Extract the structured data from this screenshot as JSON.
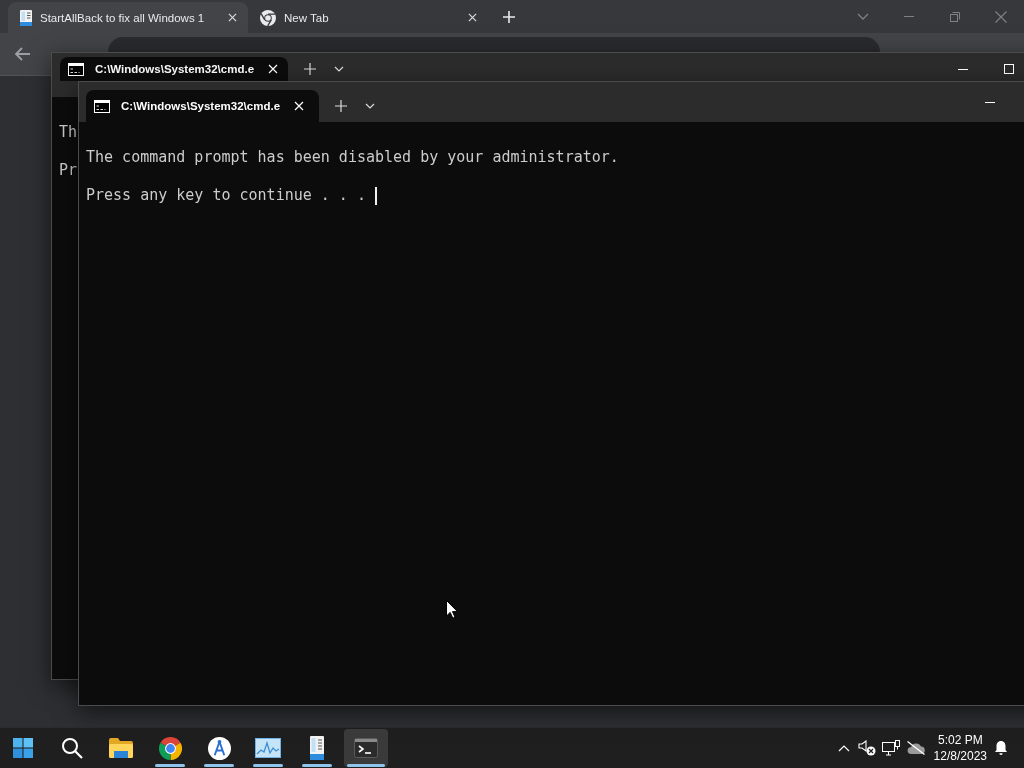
{
  "browser": {
    "tabs": [
      {
        "title": "StartAllBack to fix all Windows 1",
        "selected": true
      },
      {
        "title": "New Tab",
        "selected": false
      }
    ]
  },
  "terminals": [
    {
      "tabs": [
        {
          "title": "C:\\Windows\\System32\\cmd.e",
          "selected": true
        }
      ],
      "controls": [
        {
          "kind": "minimize"
        },
        {
          "kind": "maximize"
        }
      ],
      "lines": [
        "Th",
        "Pr"
      ]
    },
    {
      "tabs": [
        {
          "title": "C:\\Windows\\System32\\cmd.e",
          "selected": true
        }
      ],
      "controls": [
        {
          "kind": "minimize"
        }
      ],
      "lines": [
        "The command prompt has been disabled by your administrator.",
        "Press any key to continue . . ."
      ],
      "cursor": true
    }
  ],
  "taskbar": {
    "apps": [
      {
        "running": false,
        "selected": false
      },
      {
        "running": true,
        "selected": false
      },
      {
        "running": true,
        "selected": false
      },
      {
        "running": true,
        "selected": false
      },
      {
        "running": true,
        "selected": false
      },
      {
        "running": true,
        "selected": true
      }
    ],
    "clock": {
      "time": "5:02 PM",
      "date": "12/8/2023"
    }
  }
}
